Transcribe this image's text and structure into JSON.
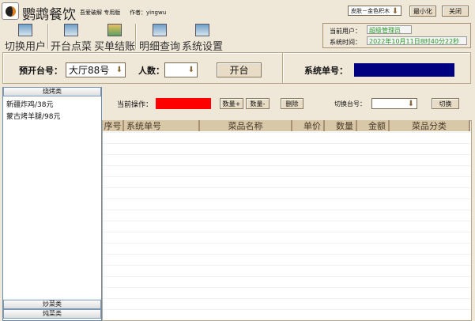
{
  "app": {
    "title": "鹦鹉餐饮",
    "edition": "吾爱破解 专用版",
    "author": "作者：yingwu"
  },
  "skin": {
    "value": "皮肤－金色积木"
  },
  "window": {
    "minimize": "最小化",
    "close": "关闭"
  },
  "toolbar": [
    {
      "label": "切换用户",
      "icon": "switch-user-icon"
    },
    {
      "label": "开台点菜",
      "icon": "order-icon"
    },
    {
      "label": "买单结账",
      "icon": "checkout-icon"
    },
    {
      "label": "明细查询",
      "icon": "query-icon"
    },
    {
      "label": "系统设置",
      "icon": "settings-icon"
    }
  ],
  "info": {
    "user_label": "当前用户：",
    "user": "超级管理员",
    "time_label": "系统时间：",
    "time": "2022年10月11日8时40分22秒"
  },
  "open": {
    "table_label": "预开台号：",
    "table_value": "大厅88号",
    "people_label": "人数：",
    "people_value": "",
    "open_button": "开台",
    "order_no_label": "系统单号：",
    "order_no_value": ""
  },
  "ops": {
    "current_label": "当前操作：",
    "qty_plus": "数量+",
    "qty_minus": "数量-",
    "delete": "删除",
    "switch_label": "切换台号：",
    "switch_value": "",
    "switch_button": "切换"
  },
  "categories": {
    "top": "烧烤类",
    "items": [
      "新疆炸鸡/38元",
      "蒙古烤羊腿/98元"
    ],
    "bottom": [
      "炒菜类",
      "炖菜类"
    ]
  },
  "grid": {
    "columns": [
      "序号",
      "系统单号",
      "菜品名称",
      "单价",
      "数量",
      "金额",
      "菜品分类"
    ]
  },
  "colors": {
    "operation_indicator": "#ff0000",
    "order_no_box": "#000080",
    "info_text": "#2a9a2a"
  }
}
